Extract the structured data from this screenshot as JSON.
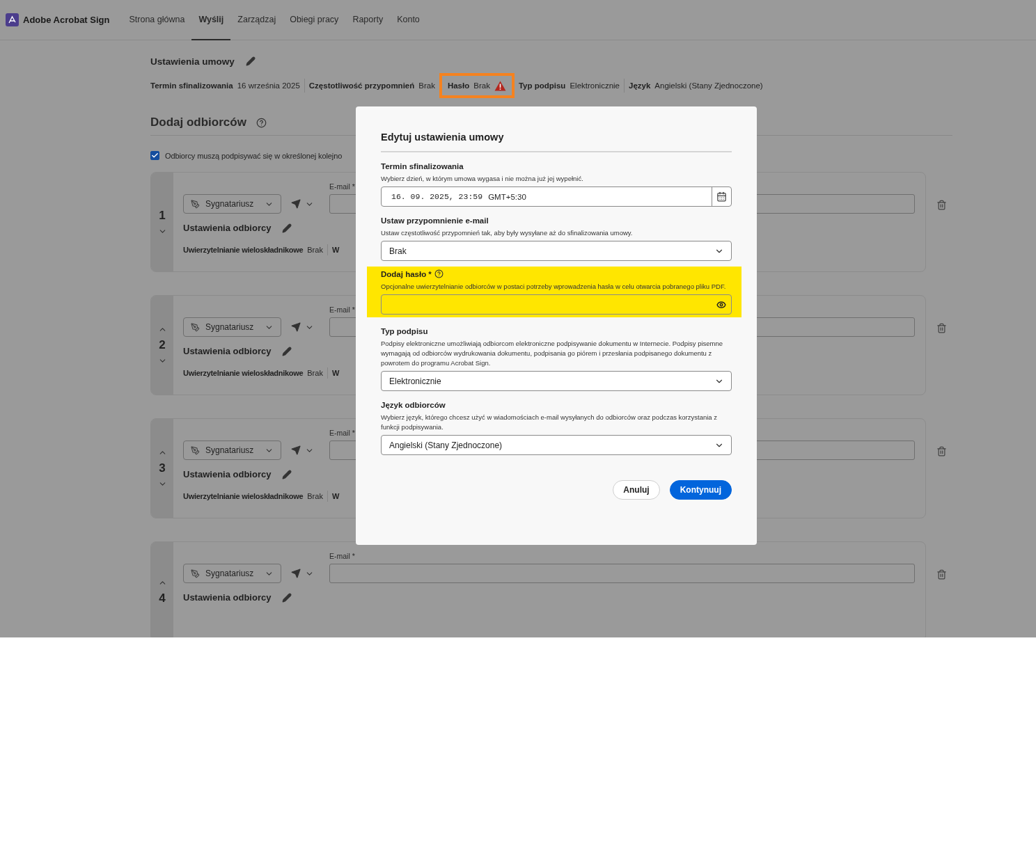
{
  "app": {
    "name": "Adobe Acrobat Sign"
  },
  "nav": [
    {
      "label": "Strona główna",
      "selected": false
    },
    {
      "label": "Wyślij",
      "selected": true
    },
    {
      "label": "Zarządzaj",
      "selected": false
    },
    {
      "label": "Obiegi pracy",
      "selected": false
    },
    {
      "label": "Raporty",
      "selected": false
    },
    {
      "label": "Konto",
      "selected": false
    }
  ],
  "agreement_settings": {
    "title": "Ustawienia umowy",
    "items": [
      {
        "label": "Termin sfinalizowania",
        "value": "16 września 2025",
        "warning": false,
        "highlighted": false
      },
      {
        "label": "Częstotliwość przypomnień",
        "value": "Brak",
        "warning": false,
        "highlighted": false
      },
      {
        "label": "Hasło",
        "value": "Brak",
        "warning": true,
        "highlighted": true
      },
      {
        "label": "Typ podpisu",
        "value": "Elektronicznie",
        "warning": false,
        "highlighted": false
      },
      {
        "label": "Język",
        "value": "Angielski (Stany Zjednoczone)",
        "warning": false,
        "highlighted": false
      }
    ]
  },
  "recipients": {
    "title": "Dodaj odbiorców",
    "sequential": {
      "label": "Odbiorcy muszą podpisywać się w określonej kolejno",
      "checked": true
    },
    "items": [
      {
        "number": "1",
        "role": "Sygnatariusz",
        "email_label": "E-mail *",
        "settings_title": "Ustawienia odbiorcy",
        "can_move_up": false,
        "can_move_down": true,
        "details": [
          {
            "label": "Uwierzytelnianie wieloskładnikowe",
            "value": "Brak"
          },
          {
            "label": "W"
          }
        ]
      },
      {
        "number": "2",
        "role": "Sygnatariusz",
        "email_label": "E-mail *",
        "settings_title": "Ustawienia odbiorcy",
        "can_move_up": true,
        "can_move_down": true,
        "details": [
          {
            "label": "Uwierzytelnianie wieloskładnikowe",
            "value": "Brak"
          },
          {
            "label": "W"
          }
        ]
      },
      {
        "number": "3",
        "role": "Sygnatariusz",
        "email_label": "E-mail *",
        "settings_title": "Ustawienia odbiorcy",
        "can_move_up": true,
        "can_move_down": true,
        "details": [
          {
            "label": "Uwierzytelnianie wieloskładnikowe",
            "value": "Brak"
          },
          {
            "label": "W"
          }
        ]
      },
      {
        "number": "4",
        "role": "Sygnatariusz",
        "email_label": "E-mail *",
        "settings_title": "Ustawienia odbiorcy",
        "can_move_up": true,
        "can_move_down": false
      }
    ]
  },
  "dialog": {
    "title": "Edytuj ustawienia umowy",
    "fields": [
      {
        "kind": "date",
        "label": "Termin sfinalizowania",
        "help": "Wybierz dzień, w którym umowa wygasa i nie można już jej wypełnić.",
        "value": "16. 09. 2025, 23:59",
        "timezone": "GMT+5:30",
        "has_help_icon": false,
        "highlighted": false
      },
      {
        "kind": "select",
        "label": "Ustaw przypomnienie e-mail",
        "help": "Ustaw częstotliwość przypomnień tak, aby były wysyłane aż do sfinalizowania umowy.",
        "value": "Brak",
        "has_help_icon": false,
        "highlighted": false
      },
      {
        "kind": "password",
        "label": "Dodaj hasło *",
        "help": "Opcjonalne uwierzytelnianie odbiorców w postaci potrzeby wprowadzenia hasła w celu otwarcia pobranego pliku PDF.",
        "has_help_icon": true,
        "highlighted": true
      },
      {
        "kind": "select",
        "label": "Typ podpisu",
        "help": "Podpisy elektroniczne umożliwiają odbiorcom elektroniczne podpisywanie dokumentu w Internecie. Podpisy pisemne wymagają od odbiorców wydrukowania dokumentu, podpisania go piórem i przesłania podpisanego dokumentu z powrotem do programu Acrobat Sign.",
        "value": "Elektronicznie",
        "has_help_icon": false,
        "highlighted": false
      },
      {
        "kind": "select",
        "label": "Język odbiorców",
        "help": "Wybierz język, którego chcesz użyć w wiadomościach e-mail wysyłanych do odbiorców oraz podczas korzystania z funkcji podpisywania.",
        "value": "Angielski (Stany Zjednoczone)",
        "has_help_icon": false,
        "highlighted": false
      }
    ],
    "buttons": [
      {
        "kind": "secondary",
        "label": "Anuluj"
      },
      {
        "kind": "primary",
        "label": "Kontynuuj"
      }
    ]
  }
}
